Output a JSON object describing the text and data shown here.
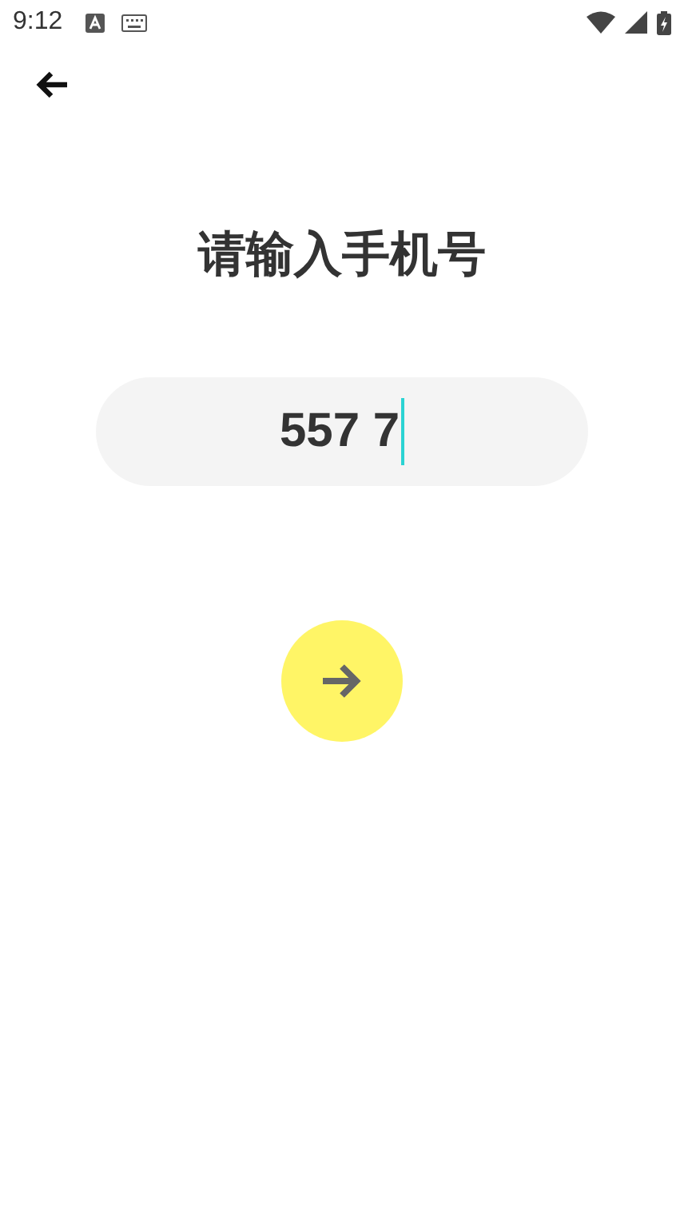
{
  "status_bar": {
    "time": "9:12"
  },
  "title": "请输入手机号",
  "phone_field": {
    "value": "557 7"
  }
}
